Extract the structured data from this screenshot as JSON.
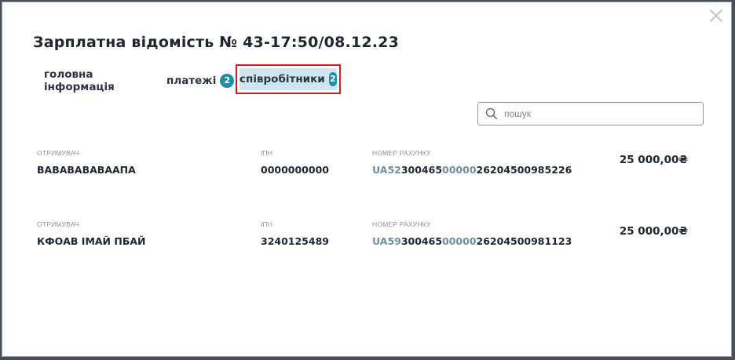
{
  "dialog": {
    "title": "Зарплатна відомість № 43-17:50/08.12.23",
    "close_icon": "close-icon"
  },
  "tabs": [
    {
      "label": "головна інформація"
    },
    {
      "label": "платежі",
      "badge": "2"
    },
    {
      "label": "співробітники",
      "badge": "2",
      "active": true
    }
  ],
  "search": {
    "placeholder": "пошук",
    "value": "",
    "icon": "search-icon"
  },
  "columns": {
    "recipient": "ОТРИМУВАЧ",
    "ipn": "ІПН",
    "account": "НОМЕР РАХУНКУ"
  },
  "employees": [
    {
      "recipient": "ВАВАВАВАВААПА",
      "ipn": "0000000000",
      "account_parts": [
        "UA52",
        "300465",
        "00000",
        "26204500985226"
      ],
      "amount": "25 000,00₴"
    },
    {
      "recipient": "КФОАВ ІМАЙ ПБАЙ",
      "ipn": "3240125489",
      "account_parts": [
        "UA59",
        "300465",
        "00000",
        "26204500981123"
      ],
      "amount": "25 000,00₴"
    }
  ],
  "colors": {
    "accent": "#1f8fa6",
    "active_tab_bg": "#cde6ef",
    "highlight_border": "#e3141b"
  }
}
